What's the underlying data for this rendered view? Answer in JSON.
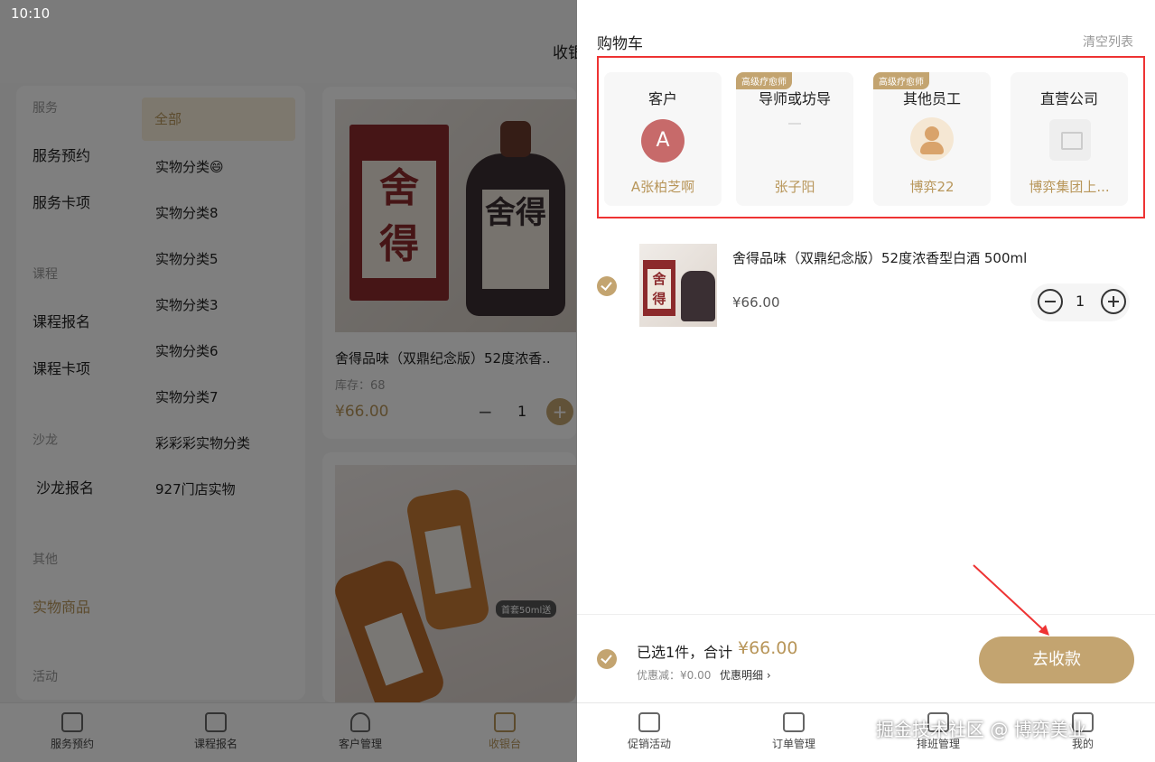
{
  "status": {
    "time": "10:10"
  },
  "background": {
    "title": "收银",
    "categories": [
      {
        "group": "服务",
        "items": [
          "服务预约",
          "服务卡项"
        ]
      },
      {
        "group": "课程",
        "items": [
          "课程报名",
          "课程卡项"
        ]
      },
      {
        "group": "沙龙",
        "items": [
          "沙龙报名"
        ]
      },
      {
        "group": "其他",
        "items": [
          "实物商品"
        ]
      },
      {
        "group": "活动",
        "items": []
      }
    ],
    "subcategories": [
      "全部",
      "实物分类😄",
      "实物分类8",
      "实物分类5",
      "实物分类3",
      "实物分类6",
      "实物分类7",
      "彩彩彩实物分类",
      "927门店实物"
    ],
    "product": {
      "name": "舍得品味（双鼎纪念版）52度浓香..",
      "stock": "库存：68",
      "price": "¥66.00",
      "qty": "1",
      "label_big": "舍得",
      "minus": "−",
      "plus": "+"
    },
    "product2_badge": "首套50ml送"
  },
  "tabs": [
    "服务预约",
    "课程报名",
    "客户管理",
    "收银台",
    "促销活动",
    "订单管理",
    "排班管理",
    "我的"
  ],
  "cart": {
    "title": "购物车",
    "clear": "清空列表",
    "staff": [
      {
        "role": "客户",
        "name": "A张柏芝啊",
        "avatar_letter": "A",
        "tag": ""
      },
      {
        "role": "导师或坊导",
        "name": "张子阳",
        "tag": "高级疗愈师"
      },
      {
        "role": "其他员工",
        "name": "博弈22",
        "tag": "高级疗愈师"
      },
      {
        "role": "直营公司",
        "name": "博弈集团上...",
        "tag": ""
      }
    ],
    "item": {
      "name": "舍得品味（双鼎纪念版）52度浓香型白酒 500ml",
      "price": "¥66.00",
      "qty": "1",
      "thumb_label": "舍得"
    },
    "footer": {
      "summary": "已选1件，合计",
      "total": "¥66.00",
      "discount": "优惠减：¥0.00",
      "detail": "优惠明细 ›",
      "pay": "去收款"
    }
  },
  "watermark": "掘金技术社区 @ 博弈美业",
  "colors": {
    "accent": "#c3a470",
    "highlight_border": "#ee3333"
  }
}
